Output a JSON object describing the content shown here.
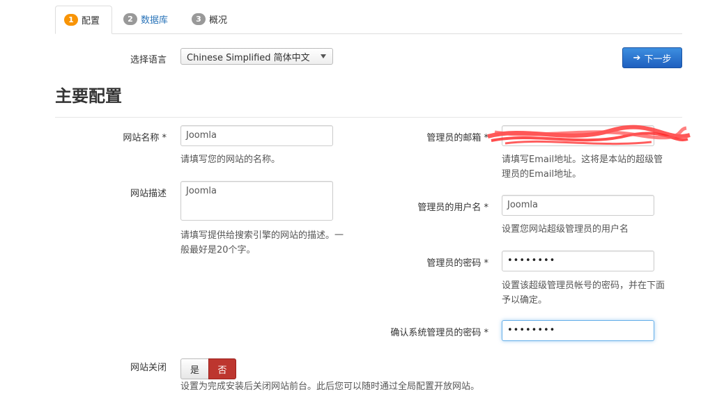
{
  "tabs": [
    {
      "num": "1",
      "label": "配置",
      "color": "#f89406",
      "text_color": "#333333"
    },
    {
      "num": "2",
      "label": "数据库",
      "color": "#999999",
      "text_color": "#2a74b9"
    },
    {
      "num": "3",
      "label": "概况",
      "color": "#999999",
      "text_color": "#333333"
    }
  ],
  "language": {
    "label": "选择语言",
    "selected": "Chinese Simplified 简体中文"
  },
  "next_button": {
    "label": "下一步",
    "icon": "arrow-right-icon"
  },
  "section_title": "主要配置",
  "site_name": {
    "label": "网站名称 *",
    "value": "Joomla",
    "help": "请填写您的网站的名称。"
  },
  "site_desc": {
    "label": "网站描述",
    "value": "Joomla",
    "help_line1": "请填写提供给搜索引擎的网站的描述。一",
    "help_line2": "般最好是20个字。"
  },
  "admin_email": {
    "label": "管理员的邮箱 *",
    "value": "",
    "help_line1": "请填写Email地址。这将是本站的超级管",
    "help_line2": "理员的Email地址。"
  },
  "admin_user": {
    "label": "管理员的用户名 *",
    "value": "Joomla",
    "help": "设置您网站超级管理员的用户名"
  },
  "admin_pass": {
    "label": "管理员的密码 *",
    "value": "••••••••",
    "help_line1": "设置该超级管理员帐号的密码，并在下面",
    "help_line2": "予以确定。"
  },
  "admin_pass_confirm": {
    "label": "确认系统管理员的密码 *",
    "value": "••••••••"
  },
  "site_offline": {
    "label": "网站关闭",
    "yes": "是",
    "no": "否",
    "selected": "否",
    "help": "设置为完成安装后关闭网站前台。此后您可以随时通过全局配置开放网站。"
  },
  "colors": {
    "accent_blue": "#1e5fbf",
    "danger_red": "#bd362f",
    "active_step": "#f89406"
  }
}
